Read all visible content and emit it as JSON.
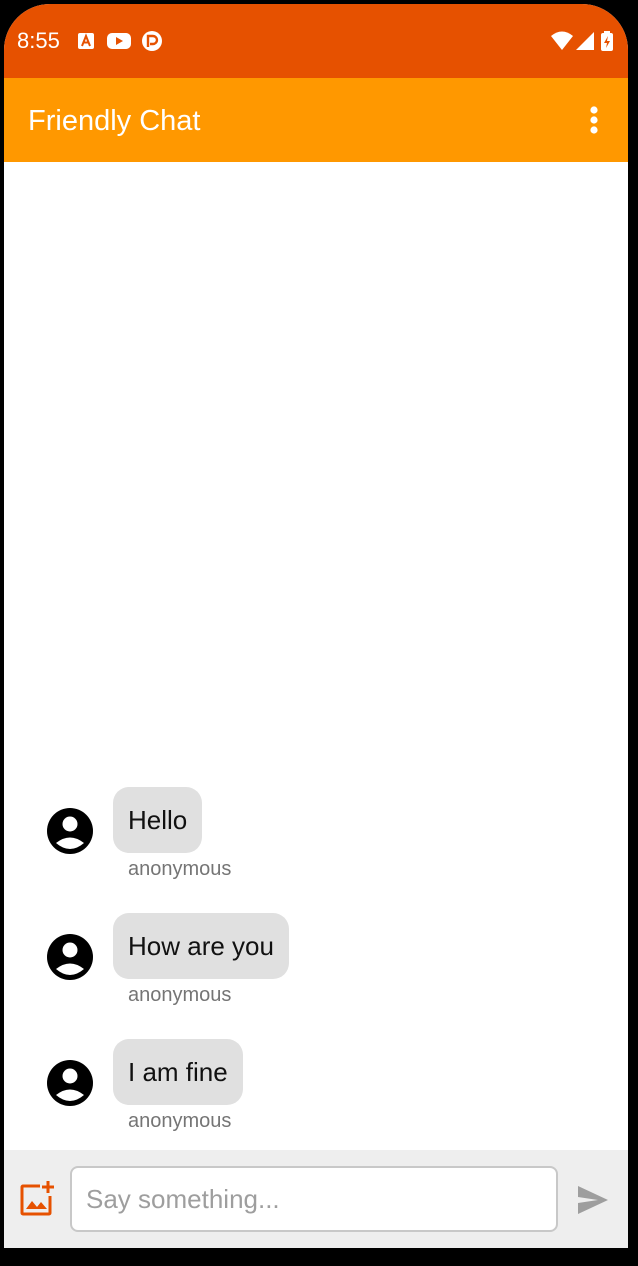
{
  "status_bar": {
    "time": "8:55",
    "icons": [
      "adobe-icon",
      "youtube-icon",
      "notification-app-icon",
      "wifi-icon",
      "signal-icon",
      "battery-icon"
    ]
  },
  "app_bar": {
    "title": "Friendly Chat",
    "overflow_icon": "more-vert-icon"
  },
  "messages": [
    {
      "text": "Hello",
      "author": "anonymous",
      "avatar_icon": "account-circle-icon"
    },
    {
      "text": "How are you",
      "author": "anonymous",
      "avatar_icon": "account-circle-icon"
    },
    {
      "text": "I am fine",
      "author": "anonymous",
      "avatar_icon": "account-circle-icon"
    }
  ],
  "composer": {
    "placeholder": "Say something...",
    "value": "",
    "add_image_icon": "add-photo-icon",
    "send_icon": "send-icon"
  },
  "colors": {
    "status_bar": "#e65100",
    "app_bar": "#ff9800",
    "bubble": "#e0e0e0",
    "accent_icon": "#e65100",
    "author_text": "#757575"
  }
}
